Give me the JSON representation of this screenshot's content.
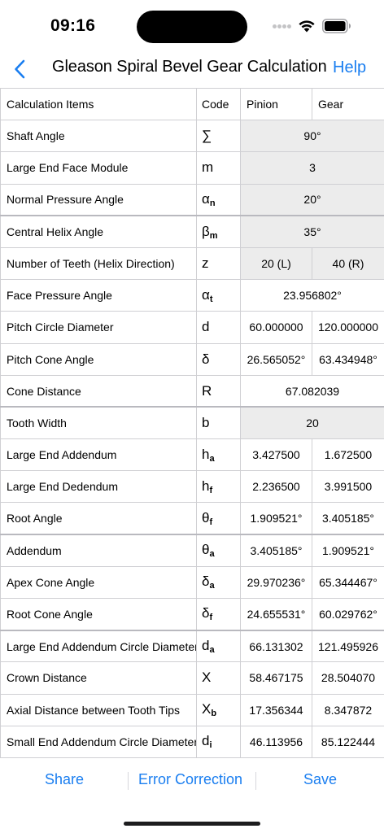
{
  "status_bar": {
    "time": "09:16"
  },
  "nav": {
    "title": "Gleason Spiral Bevel Gear Calculation",
    "help_label": "Help"
  },
  "table": {
    "headers": {
      "item": "Calculation Items",
      "code": "Code",
      "pinion": "Pinion",
      "gear": "Gear"
    },
    "rows": [
      {
        "item": "Shaft Angle",
        "code": "∑",
        "sub": "",
        "value": "90°",
        "input": true
      },
      {
        "item": "Large End Face Module",
        "code": "m",
        "sub": "",
        "value": "3",
        "input": true
      },
      {
        "item": "Normal Pressure Angle",
        "code": "α",
        "sub": "n",
        "value": "20°",
        "input": true
      },
      {
        "item": "Central Helix Angle",
        "code": "β",
        "sub": "m",
        "value": "35°",
        "input": true
      },
      {
        "item": "Number of Teeth (Helix Direction)",
        "code": "z",
        "sub": "",
        "pinion": "20 (L)",
        "gear": "40 (R)",
        "input": true
      },
      {
        "item": "Face Pressure Angle",
        "code": "α",
        "sub": "t",
        "value": "23.956802°"
      },
      {
        "item": "Pitch Circle Diameter",
        "code": "d",
        "sub": "",
        "pinion": "60.000000",
        "gear": "120.000000"
      },
      {
        "item": "Pitch Cone Angle",
        "code": "δ",
        "sub": "",
        "pinion": "26.565052°",
        "gear": "63.434948°"
      },
      {
        "item": "Cone Distance",
        "code": "R",
        "sub": "",
        "value": "67.082039"
      },
      {
        "item": "Tooth Width",
        "code": "b",
        "sub": "",
        "value": "20",
        "input": true
      },
      {
        "item": "Large End Addendum",
        "code": "h",
        "sub": "a",
        "pinion": "3.427500",
        "gear": "1.672500"
      },
      {
        "item": "Large End Dedendum",
        "code": "h",
        "sub": "f",
        "pinion": "2.236500",
        "gear": "3.991500"
      },
      {
        "item": "Root Angle",
        "code": "θ",
        "sub": "f",
        "pinion": "1.909521°",
        "gear": "3.405185°"
      },
      {
        "item": "Addendum",
        "code": "θ",
        "sub": "a",
        "pinion": "3.405185°",
        "gear": "1.909521°"
      },
      {
        "item": "Apex Cone Angle",
        "code": "δ",
        "sub": "a",
        "pinion": "29.970236°",
        "gear": "65.344467°"
      },
      {
        "item": "Root Cone Angle",
        "code": "δ",
        "sub": "f",
        "pinion": "24.655531°",
        "gear": "60.029762°"
      },
      {
        "item": "Large End Addendum Circle Diameter",
        "code": "d",
        "sub": "a",
        "pinion": "66.131302",
        "gear": "121.495926"
      },
      {
        "item": "Crown Distance",
        "code": "X",
        "sub": "",
        "pinion": "58.467175",
        "gear": "28.504070"
      },
      {
        "item": "Axial Distance between Tooth Tips",
        "code": "X",
        "sub": "b",
        "pinion": "17.356344",
        "gear": "8.347872"
      },
      {
        "item": "Small End Addendum Circle Diameter",
        "code": "d",
        "sub": "i",
        "pinion": "46.113956",
        "gear": "85.122444"
      }
    ]
  },
  "bottom_bar": {
    "share_label": "Share",
    "error_correction_label": "Error Correction",
    "save_label": "Save"
  },
  "colors": {
    "accent": "#1a7ef0",
    "input_bg": "#ececec",
    "grid": "#cfcfd3"
  }
}
